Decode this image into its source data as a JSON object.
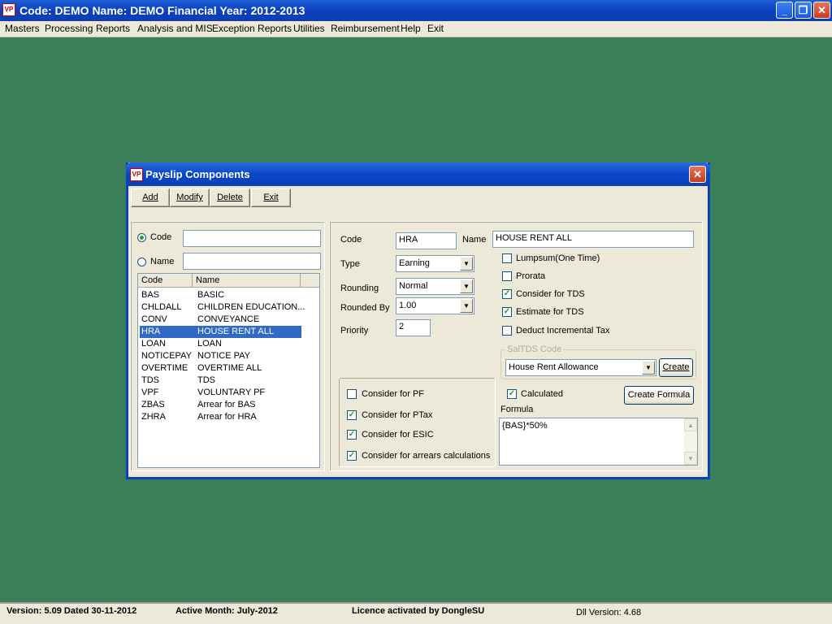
{
  "window": {
    "title": "Code: DEMO Name: DEMO Financial Year: 2012-2013",
    "icon": "app-icon",
    "minimize": "_",
    "maximize": "❐",
    "close": "✕"
  },
  "menu": [
    "Masters",
    "Processing",
    "Reports",
    "Analysis and MIS",
    "Exception Reports",
    "Utilities",
    "Reimbursement",
    "Help",
    "Exit"
  ],
  "status": {
    "version": "Version: 5.09 Dated 30-11-2012",
    "month": "Active Month: July-2012",
    "licence": "Licence activated by DongleSU",
    "dll": "Dll Version: 4.68"
  },
  "dialog": {
    "title": "Payslip Components",
    "close": "✕",
    "toolbar": {
      "add": "Add",
      "modify": "Modify",
      "delete": "Delete",
      "exit": "Exit"
    },
    "search": {
      "code_label": "Code",
      "name_label": "Name",
      "code_value": "",
      "name_value": "",
      "selected": "code"
    },
    "list": {
      "headers": [
        "Code",
        "Name"
      ],
      "rows": [
        {
          "code": "BAS",
          "name": "BASIC"
        },
        {
          "code": "CHLDALL",
          "name": "CHILDREN EDUCATION..."
        },
        {
          "code": "CONV",
          "name": "CONVEYANCE"
        },
        {
          "code": "HRA",
          "name": "HOUSE RENT ALL",
          "selected": true
        },
        {
          "code": "LOAN",
          "name": "LOAN"
        },
        {
          "code": "NOTICEPAY",
          "name": "NOTICE PAY"
        },
        {
          "code": "OVERTIME",
          "name": "OVERTIME ALL"
        },
        {
          "code": "TDS",
          "name": "TDS"
        },
        {
          "code": "VPF",
          "name": "VOLUNTARY PF"
        },
        {
          "code": "ZBAS",
          "name": "Arrear for BAS"
        },
        {
          "code": "ZHRA",
          "name": "Arrear for HRA"
        }
      ]
    },
    "detail": {
      "code_label": "Code",
      "code_value": "HRA",
      "name_label": "Name",
      "name_value": "HOUSE RENT ALL",
      "type_label": "Type",
      "type_value": "Earning",
      "rounding_label": "Rounding",
      "rounding_value": "Normal",
      "rounded_by_label": "Rounded By",
      "rounded_by_value": "1.00",
      "priority_label": "Priority",
      "priority_value": "2",
      "lumpsum": {
        "label": "Lumpsum(One Time)",
        "checked": false
      },
      "prorata": {
        "label": "Prorata",
        "checked": false
      },
      "consider_tds": {
        "label": "Consider for TDS",
        "checked": true
      },
      "estimate_tds": {
        "label": "Estimate for TDS",
        "checked": true
      },
      "deduct_incremental": {
        "label": "Deduct Incremental Tax",
        "checked": false
      },
      "saltds_label": "SalTDS Code",
      "saltds_value": "House Rent Allowance",
      "create_label": "Create",
      "consider_pf": {
        "label": "Consider for PF",
        "checked": false
      },
      "consider_ptax": {
        "label": "Consider for PTax",
        "checked": true
      },
      "consider_esic": {
        "label": "Consider for ESIC",
        "checked": true
      },
      "consider_arrears": {
        "label": "Consider for arrears calculations",
        "checked": true
      },
      "calculated": {
        "label": "Calculated",
        "checked": true
      },
      "create_formula_label": "Create Formula",
      "formula_label": "Formula",
      "formula_value": "{BAS}*50%"
    }
  }
}
